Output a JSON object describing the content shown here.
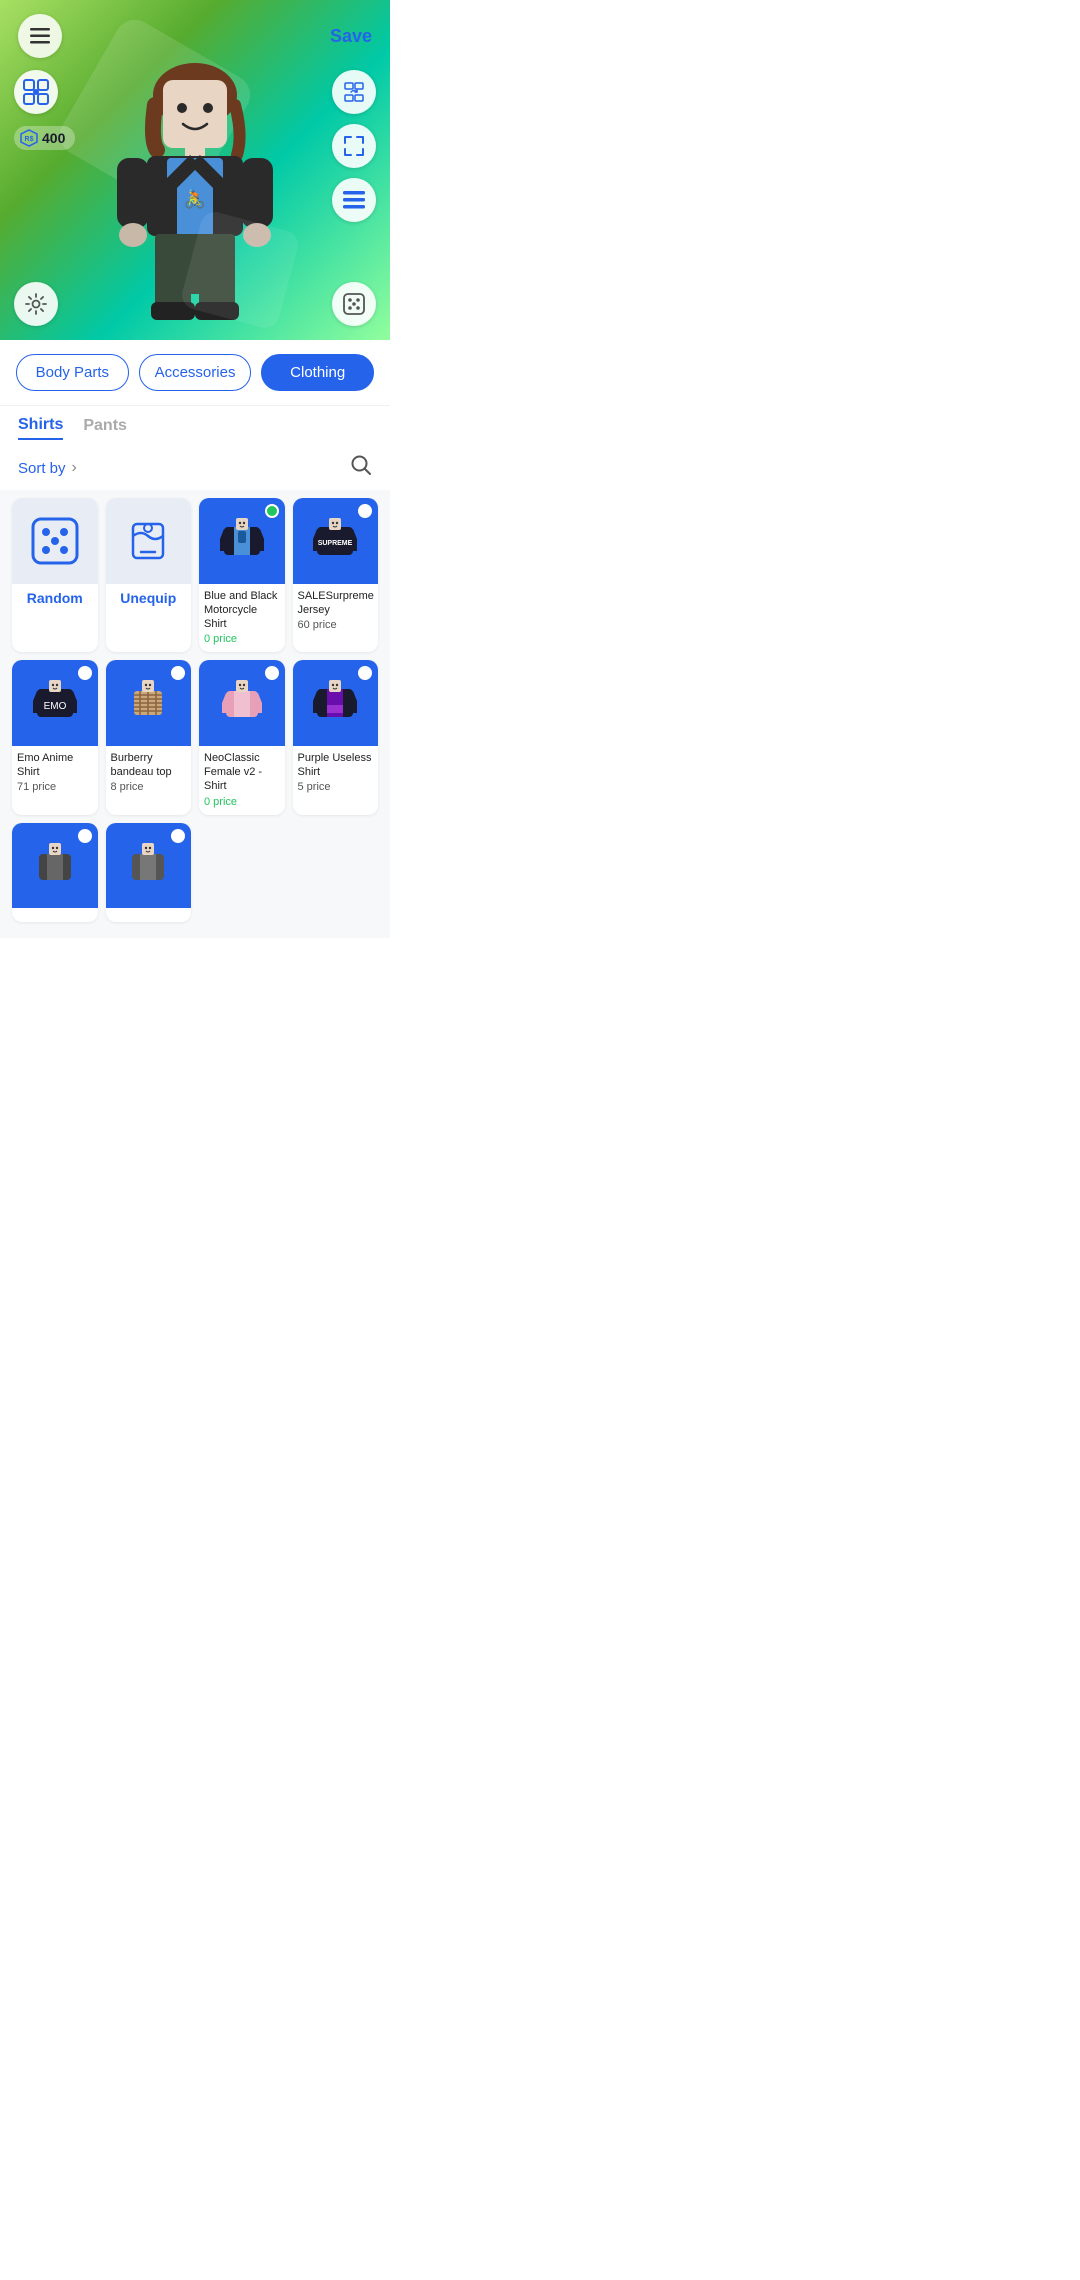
{
  "topBar": {
    "saveLabel": "Save"
  },
  "robux": {
    "amount": "400"
  },
  "categories": [
    {
      "id": "body-parts",
      "label": "Body Parts",
      "active": false
    },
    {
      "id": "accessories",
      "label": "Accessories",
      "active": false
    },
    {
      "id": "clothing",
      "label": "Clothing",
      "active": true
    }
  ],
  "subTabs": [
    {
      "id": "shirts",
      "label": "Shirts",
      "active": true
    },
    {
      "id": "pants",
      "label": "Pants",
      "active": false
    }
  ],
  "sortBy": {
    "label": "Sort by"
  },
  "specialItems": [
    {
      "id": "random",
      "label": "Random",
      "icon": "🎲"
    },
    {
      "id": "unequip",
      "label": "Unequip",
      "icon": "👕"
    }
  ],
  "items": [
    {
      "id": 1,
      "name": "Blue and Black Motorcycle Shirt",
      "price": "0 price",
      "priceClass": "free",
      "status": "green",
      "bg": "blue"
    },
    {
      "id": 2,
      "name": "SALESurpreme Jersey",
      "price": "60 price",
      "priceClass": "",
      "status": "white",
      "bg": "blue"
    },
    {
      "id": 3,
      "name": "Emo Anime Shirt",
      "price": "71 price",
      "priceClass": "",
      "status": "white",
      "bg": "blue"
    },
    {
      "id": 4,
      "name": "Burberry bandeau top",
      "price": "8 price",
      "priceClass": "",
      "status": "white",
      "bg": "blue"
    },
    {
      "id": 5,
      "name": "NeoClassic Female v2 - Shirt",
      "price": "0 price",
      "priceClass": "free",
      "status": "white",
      "bg": "blue"
    },
    {
      "id": 6,
      "name": "Purple Useless Shirt",
      "price": "5 price",
      "priceClass": "",
      "status": "white",
      "bg": "blue"
    },
    {
      "id": 7,
      "name": "",
      "price": "",
      "priceClass": "",
      "status": "white",
      "bg": "blue"
    },
    {
      "id": 8,
      "name": "",
      "price": "",
      "priceClass": "",
      "status": "white",
      "bg": "blue"
    }
  ],
  "icons": {
    "hamburger": "☰",
    "robuxSymbol": "⬡",
    "imageRotate": "🔄",
    "expand": "⤢",
    "list": "≡",
    "gear": "⚙",
    "dice": "🎲",
    "search": "🔍",
    "chevronRight": "›"
  }
}
